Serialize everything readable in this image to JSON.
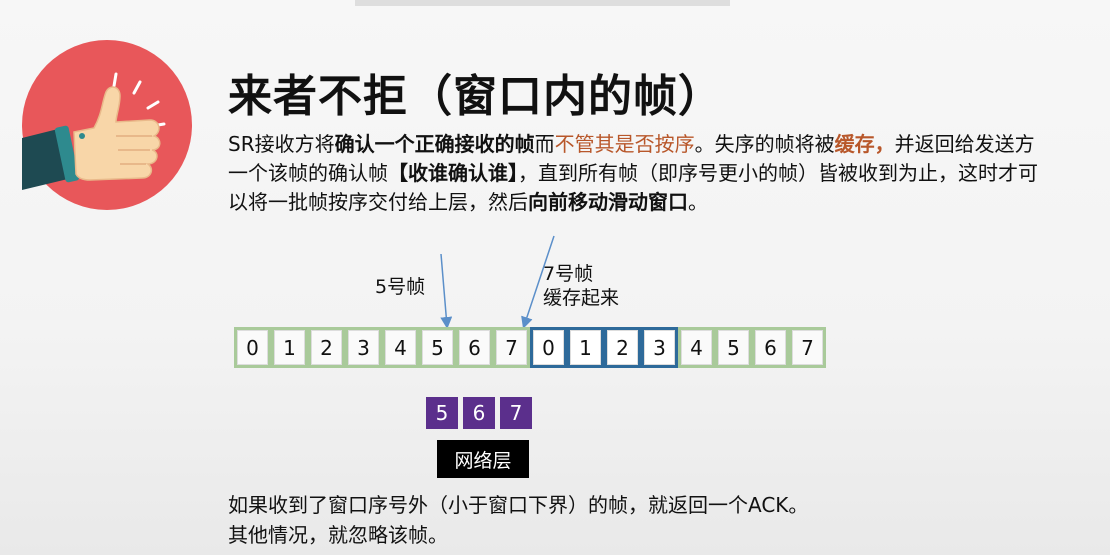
{
  "title": "来者不拒（窗口内的帧）",
  "description": {
    "t1": "SR接收方将",
    "t2": "确认一个正确接收的帧",
    "t3": "而",
    "t4": "不管其是否按序",
    "t5": "。失序的帧将被",
    "t6": "缓存，",
    "t7": "并返回给发送方一个该帧的确认帧",
    "t8": "【收谁确认谁】",
    "t9": "，直到所有帧（即序号更小的帧）皆被收到为止，这时才可以将一批帧按序交付给上层，然后",
    "t10": "向前移动滑动窗口",
    "t11": "。"
  },
  "labels": {
    "frame5": "5号帧",
    "frame7_line1": "7号帧",
    "frame7_line2": "缓存起来"
  },
  "sequence": [
    "0",
    "1",
    "2",
    "3",
    "4",
    "5",
    "6",
    "7",
    "0",
    "1",
    "2",
    "3",
    "4",
    "5",
    "6",
    "7"
  ],
  "delivered": [
    "5",
    "6",
    "7"
  ],
  "network_layer": "网络层",
  "footer": {
    "line1": "如果收到了窗口序号外（小于窗口下界）的帧，就返回一个ACK。",
    "line2": "其他情况，就忽略该帧。"
  },
  "colors": {
    "logo_bg": "#e8575a",
    "accent_orange": "#b8572a",
    "window_border": "#2e6a9a",
    "cell_border": "#a9ca9a",
    "delivered_bg": "#5b2f8c"
  },
  "icons": {
    "logo": "thumbs-up-icon"
  }
}
